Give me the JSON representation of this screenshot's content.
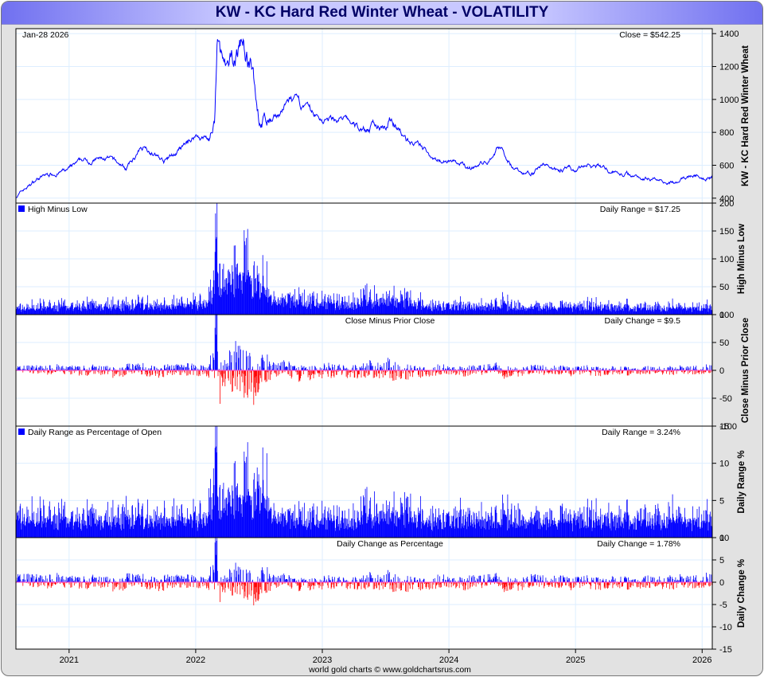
{
  "title": "KW  -  KC Hard Red Winter Wheat - VOLATILITY",
  "footer": "world gold charts © www.goldchartsrus.com",
  "colors": {
    "up": "#0000ff",
    "down": "#ff0000",
    "zero_line": "#ff44cc",
    "grid": "#ddeeff",
    "price_line": "#0000ff"
  },
  "chart_data": [
    {
      "type": "line",
      "name": "price",
      "date_label": "Jan-28  2026",
      "readout": "Close = $542.25",
      "ylabel": "KW  -  KC Hard Red Winter Wheat",
      "ylim": [
        370,
        1430
      ],
      "yticks": [
        400,
        600,
        800,
        1000,
        1200,
        1400
      ],
      "x_years": [
        2020.58,
        2026.08
      ],
      "points": [
        [
          2020.58,
          410
        ],
        [
          2020.75,
          520
        ],
        [
          2020.9,
          560
        ],
        [
          2021.0,
          570
        ],
        [
          2021.1,
          620
        ],
        [
          2021.3,
          640
        ],
        [
          2021.45,
          580
        ],
        [
          2021.6,
          720
        ],
        [
          2021.75,
          620
        ],
        [
          2021.9,
          700
        ],
        [
          2022.0,
          780
        ],
        [
          2022.1,
          760
        ],
        [
          2022.15,
          820
        ],
        [
          2022.17,
          1300
        ],
        [
          2022.25,
          1100
        ],
        [
          2022.37,
          1370
        ],
        [
          2022.45,
          1150
        ],
        [
          2022.5,
          900
        ],
        [
          2022.6,
          850
        ],
        [
          2022.75,
          1000
        ],
        [
          2022.85,
          940
        ],
        [
          2023.0,
          870
        ],
        [
          2023.15,
          880
        ],
        [
          2023.3,
          820
        ],
        [
          2023.45,
          840
        ],
        [
          2023.55,
          890
        ],
        [
          2023.65,
          760
        ],
        [
          2023.8,
          690
        ],
        [
          2023.9,
          640
        ],
        [
          2024.0,
          640
        ],
        [
          2024.15,
          580
        ],
        [
          2024.3,
          620
        ],
        [
          2024.4,
          720
        ],
        [
          2024.5,
          600
        ],
        [
          2024.6,
          540
        ],
        [
          2024.75,
          600
        ],
        [
          2024.9,
          580
        ],
        [
          2025.0,
          560
        ],
        [
          2025.1,
          600
        ],
        [
          2025.3,
          560
        ],
        [
          2025.5,
          530
        ],
        [
          2025.65,
          520
        ],
        [
          2025.8,
          490
        ],
        [
          2025.9,
          530
        ],
        [
          2026.08,
          542.25
        ]
      ]
    },
    {
      "type": "bar",
      "name": "high_minus_low",
      "legend": "High Minus Low",
      "readout": "Daily Range = $17.25",
      "ylabel": "High Minus Low",
      "ylim": [
        0,
        200
      ],
      "yticks": [
        0,
        50,
        100,
        150,
        200
      ],
      "last_value": 17.25
    },
    {
      "type": "bar",
      "name": "close_minus_prior_close",
      "legend": "Close Minus Prior Close",
      "readout": "Daily Change = $9.5",
      "ylabel": "Close Minus Prior Close",
      "ylim": [
        -100,
        100
      ],
      "yticks": [
        -100,
        -50,
        0,
        50,
        100
      ],
      "last_value": 9.5
    },
    {
      "type": "bar",
      "name": "daily_range_pct",
      "legend": "Daily Range as Percentage of Open",
      "readout": "Daily Range = 3.24%",
      "ylabel": "Daily Range %",
      "ylim": [
        0,
        15
      ],
      "yticks": [
        0,
        5,
        10,
        15
      ],
      "last_value": 3.24
    },
    {
      "type": "bar",
      "name": "daily_change_pct",
      "legend": "Daily Change as Percentage",
      "readout": "Daily Change = 1.78%",
      "ylabel": "Daily Change %",
      "ylim": [
        -15,
        10
      ],
      "yticks": [
        -15,
        -10,
        -5,
        0,
        5,
        10
      ],
      "last_value": 1.78
    }
  ],
  "xticks": [
    "2021",
    "2022",
    "2023",
    "2024",
    "2025",
    "2026"
  ]
}
